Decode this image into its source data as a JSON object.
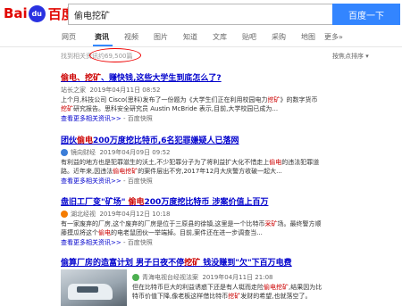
{
  "header": {
    "logo_left": "Bai",
    "logo_paw": "du",
    "logo_right": "百度",
    "search_value": "偷电挖矿",
    "search_button": "百度一下"
  },
  "tabs": [
    "网页",
    "资讯",
    "视频",
    "图片",
    "知道",
    "文库",
    "贴吧",
    "采购",
    "地图",
    "更多»"
  ],
  "stats": {
    "prefix": "找到相关资讯约",
    "count": "69,500篇"
  },
  "sort_label": "按焦点排序",
  "results": [
    {
      "title_hl": "偷电、挖矿",
      "title_rest": "、赚快钱,这些大学生到底怎么了?",
      "source": "站长之家",
      "time": "2019年04月11日 08:52",
      "snippet1": "上个月,科技公司 Cisco(思科)发布了一份题为《大学生们正在利用校园电力",
      "snippet1_hl": "挖矿",
      "snippet1_end": "》的数字货币",
      "snippet2_hl": "挖矿",
      "snippet2": "研究报告。思科安全研究员 Austin McBride 表示,目前,大学校园已成为...",
      "more": "查看更多相关资讯>>",
      "snap": "百度快照"
    },
    {
      "title_a": "团伙",
      "title_hl": "偷电",
      "title_b": "200万度挖比特币,6名犯罪嫌疑人已落网",
      "source": "镜向财经",
      "time": "2019年04月09日 09:52",
      "snippet1": "有利益的地方也是犯罪滋生的沃土,不少犯罪分子为了将利益扩大化不惜走上",
      "snippet1_hl": "偷电",
      "snippet1_end": "的违法犯罪道",
      "snippet2_a": "路。近年来,因违法",
      "snippet2_hl": "偷电挖矿",
      "snippet2": "的案件层出不穷,2017年12月大庆警方收破一起大...",
      "more": "查看更多相关资讯>>",
      "snap": "百度快照"
    },
    {
      "title_a": "盘旧工厂变\"矿场\" ",
      "title_hl": "偷电",
      "title_b": "200万度挖比特币 涉案价值上百万",
      "source": "湖北经视",
      "time": "2019年04月12日 10:18",
      "snippet1": "有一家废弃的厂房,这个废弃的厂房是位于三原县的徐镇,这里是一个比特币",
      "snippet1_hl": "采矿",
      "snippet1_end": "场。最终警方顺",
      "snippet2_a": "藤摸瓜将这个",
      "snippet2_hl": "偷电",
      "snippet2": "的电老鼠团伙一举端掉。目前,案件还在进一步调查当...",
      "more": "查看更多相关资讯>>",
      "snap": "百度快照"
    },
    {
      "title_a": "偷算厂房的造富计划 男子日夜不停",
      "title_hl": "挖矿",
      "title_b": " 钱没赚到\"欠\"下百万电费",
      "source": "青海电视台经视法案",
      "time": "2019年04月11日 21:08",
      "snippet1": "但在比特币巨大的利益诱惑下还是有人铤而走险",
      "snippet1_hl": "偷电挖矿",
      "snippet1_end": ",结果因为比",
      "snippet2_a": "特币价值下降,像老板这样借比特币",
      "snippet2_hl": "挖矿",
      "snippet2": "发财的希望,也就落空了。"
    }
  ]
}
